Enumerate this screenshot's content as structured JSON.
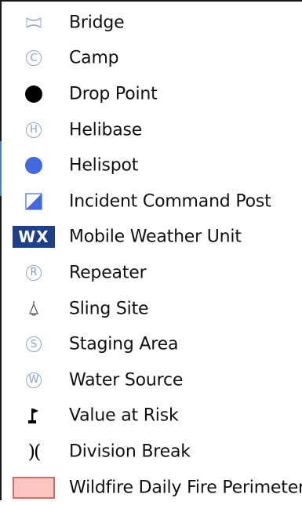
{
  "colors": {
    "window_edge": "#1a1a1a",
    "circle_symbol": "#8aa0cc",
    "helispot": "#4169e1",
    "wx_badge": "#1e3f8a",
    "perimeter_fill": "#fcc6c2",
    "perimeter_border": "#d26a65"
  },
  "legend": {
    "items": [
      {
        "label": "Bridge",
        "icon": "bridge-icon"
      },
      {
        "label": "Camp",
        "icon": "camp-icon",
        "glyph": "C"
      },
      {
        "label": "Drop Point",
        "icon": "drop-point-icon"
      },
      {
        "label": "Helibase",
        "icon": "helibase-icon",
        "glyph": "H"
      },
      {
        "label": "Helispot",
        "icon": "helispot-icon"
      },
      {
        "label": "Incident Command Post",
        "icon": "incident-command-post-icon"
      },
      {
        "label": "Mobile Weather Unit",
        "icon": "mobile-weather-unit-icon",
        "glyph": "WX"
      },
      {
        "label": "Repeater",
        "icon": "repeater-icon",
        "glyph": "R"
      },
      {
        "label": "Sling Site",
        "icon": "sling-site-icon"
      },
      {
        "label": "Staging Area",
        "icon": "staging-area-icon",
        "glyph": "S"
      },
      {
        "label": "Water Source",
        "icon": "water-source-icon",
        "glyph": "W"
      },
      {
        "label": "Value at Risk",
        "icon": "value-at-risk-icon"
      },
      {
        "label": "Division Break",
        "icon": "division-break-icon",
        "glyph": ")("
      },
      {
        "label": "Wildfire Daily Fire Perimeter",
        "icon": "fire-perimeter-icon"
      }
    ]
  }
}
